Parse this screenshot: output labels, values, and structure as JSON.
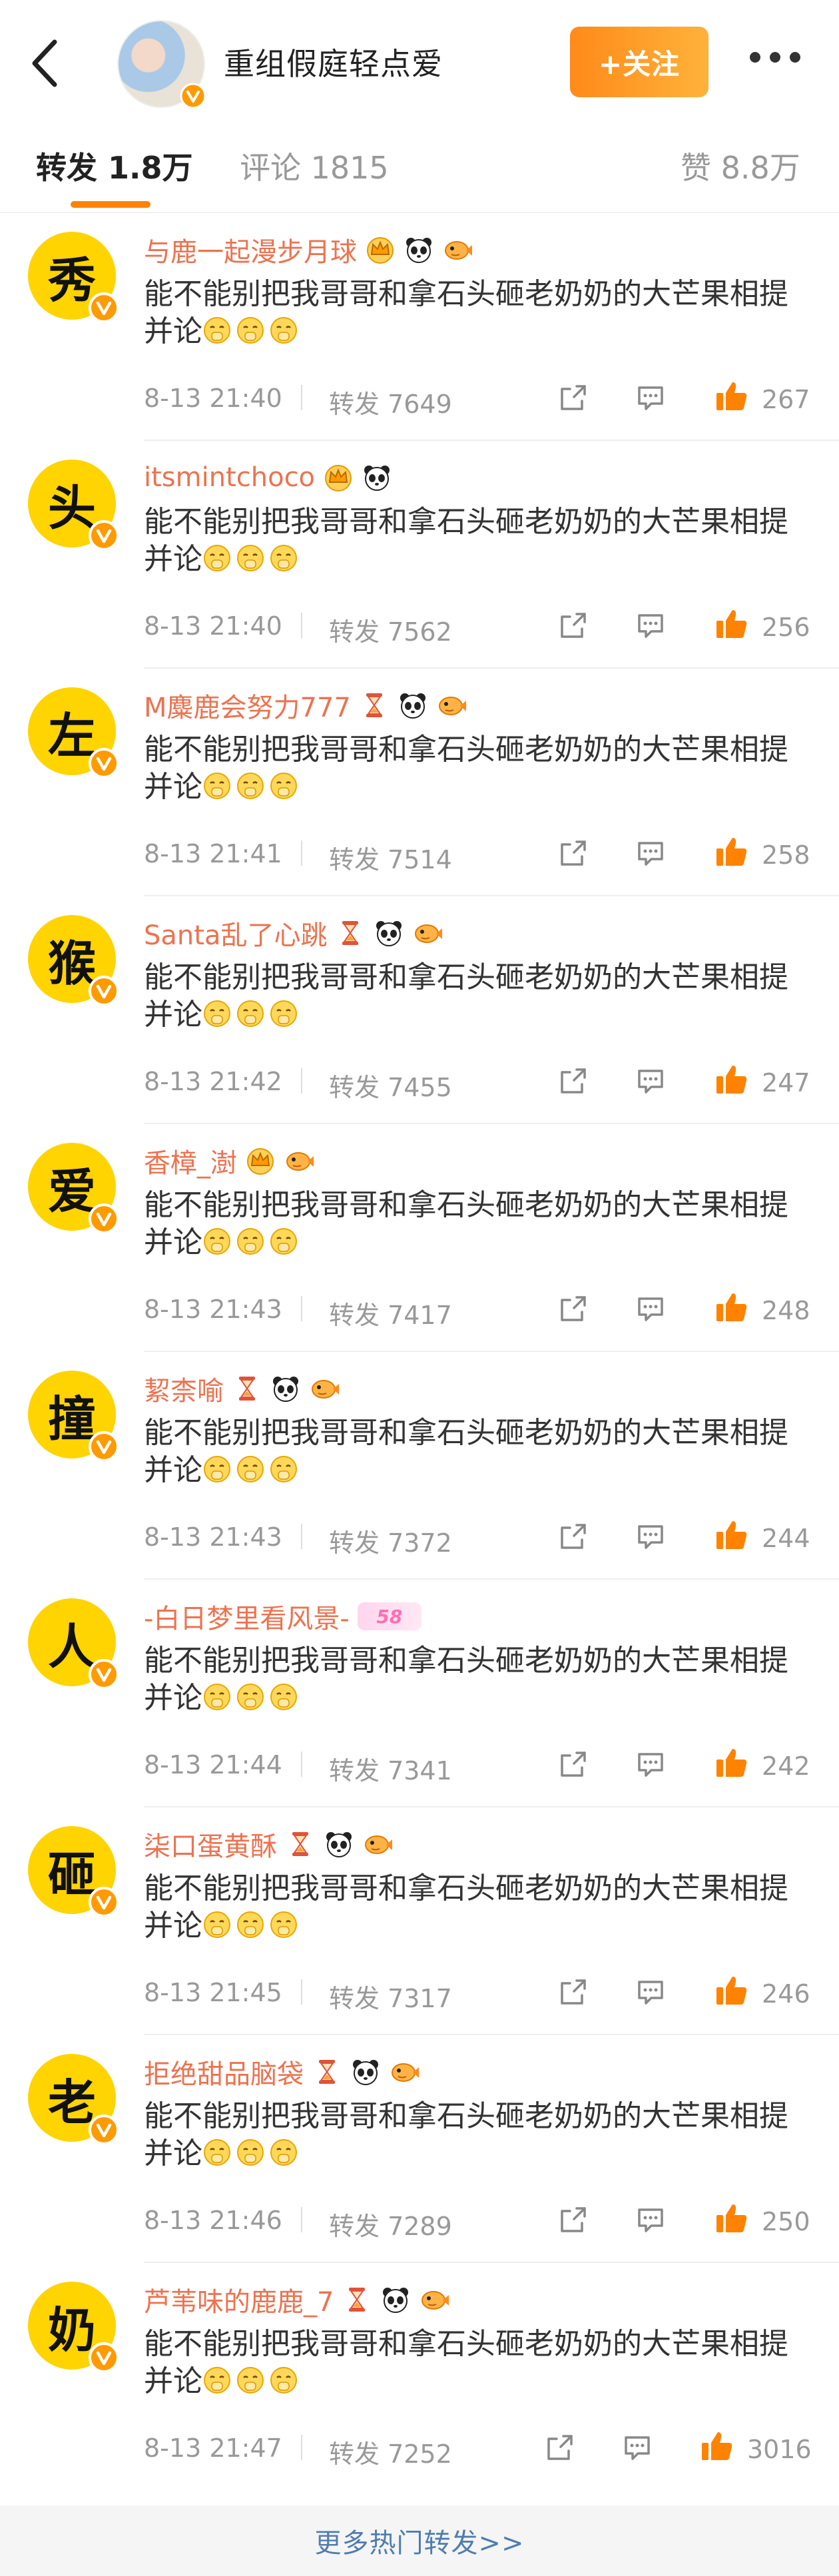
{
  "header": {
    "title": "重组假庭轻点爱",
    "follow_label": "+关注"
  },
  "tabs": [
    {
      "label": "转发 1.8万"
    },
    {
      "label": "评论 1815"
    },
    {
      "label": "赞 8.8万"
    }
  ],
  "colors": {
    "accent": "#ff8200",
    "username": "#eb7350",
    "avatar_bg": "#ffd400",
    "link": "#507daf"
  },
  "reposts": [
    {
      "avatar_char": "秀",
      "username": "与鹿一起漫步月球",
      "text": "能不能别把我哥哥和拿石头砸老奶奶的大芒果相提并论",
      "time": "8-13 21:40",
      "repost_count": "转发 7649",
      "likes": "267",
      "icons": [
        "crown-icon",
        "panda-icon",
        "fish-icon"
      ]
    },
    {
      "avatar_char": "头",
      "username": "itsmintchoco",
      "text": "能不能别把我哥哥和拿石头砸老奶奶的大芒果相提并论",
      "time": "8-13 21:40",
      "repost_count": "转发 7562",
      "likes": "256",
      "icons": [
        "crown-icon",
        "panda-icon"
      ]
    },
    {
      "avatar_char": "左",
      "username": "M麋鹿会努力777",
      "text": "能不能别把我哥哥和拿石头砸老奶奶的大芒果相提并论",
      "time": "8-13 21:41",
      "repost_count": "转发 7514",
      "likes": "258",
      "icons": [
        "hourglass-icon",
        "panda-icon",
        "fish-icon"
      ]
    },
    {
      "avatar_char": "猴",
      "username": "Santa乱了心跳",
      "text": "能不能别把我哥哥和拿石头砸老奶奶的大芒果相提并论",
      "time": "8-13 21:42",
      "repost_count": "转发 7455",
      "likes": "247",
      "icons": [
        "hourglass-icon",
        "panda-icon",
        "fish-icon"
      ]
    },
    {
      "avatar_char": "爱",
      "username": "香樟_澍",
      "text": "能不能别把我哥哥和拿石头砸老奶奶的大芒果相提并论",
      "time": "8-13 21:43",
      "repost_count": "转发 7417",
      "likes": "248",
      "icons": [
        "crown-icon",
        "fish-icon"
      ]
    },
    {
      "avatar_char": "撞",
      "username": "絜柰喻",
      "text": "能不能别把我哥哥和拿石头砸老奶奶的大芒果相提并论",
      "time": "8-13 21:43",
      "repost_count": "转发 7372",
      "likes": "244",
      "icons": [
        "hourglass-icon",
        "panda-icon",
        "fish-icon"
      ]
    },
    {
      "avatar_char": "人",
      "username": "-白日梦里看风景-",
      "text": "能不能别把我哥哥和拿石头砸老奶奶的大芒果相提并论",
      "time": "8-13 21:44",
      "repost_count": "转发 7341",
      "likes": "242",
      "icons": [
        "level-badge-icon"
      ],
      "level_badge": "58"
    },
    {
      "avatar_char": "砸",
      "username": "柒口蛋黄酥",
      "text": "能不能别把我哥哥和拿石头砸老奶奶的大芒果相提并论",
      "time": "8-13 21:45",
      "repost_count": "转发 7317",
      "likes": "246",
      "icons": [
        "hourglass-icon",
        "panda-icon",
        "fish-icon"
      ]
    },
    {
      "avatar_char": "老",
      "username": "拒绝甜品脑袋",
      "text": "能不能别把我哥哥和拿石头砸老奶奶的大芒果相提并论",
      "time": "8-13 21:46",
      "repost_count": "转发 7289",
      "likes": "250",
      "icons": [
        "hourglass-icon",
        "panda-icon",
        "fish-icon"
      ]
    },
    {
      "avatar_char": "奶",
      "username": "芦苇味的鹿鹿_7",
      "text": "能不能别把我哥哥和拿石头砸老奶奶的大芒果相提并论",
      "time": "8-13 21:47",
      "repost_count": "转发 7252",
      "likes": "3016",
      "icons": [
        "hourglass-icon",
        "panda-icon",
        "fish-icon"
      ]
    }
  ],
  "more_link": "更多热门转发>>"
}
